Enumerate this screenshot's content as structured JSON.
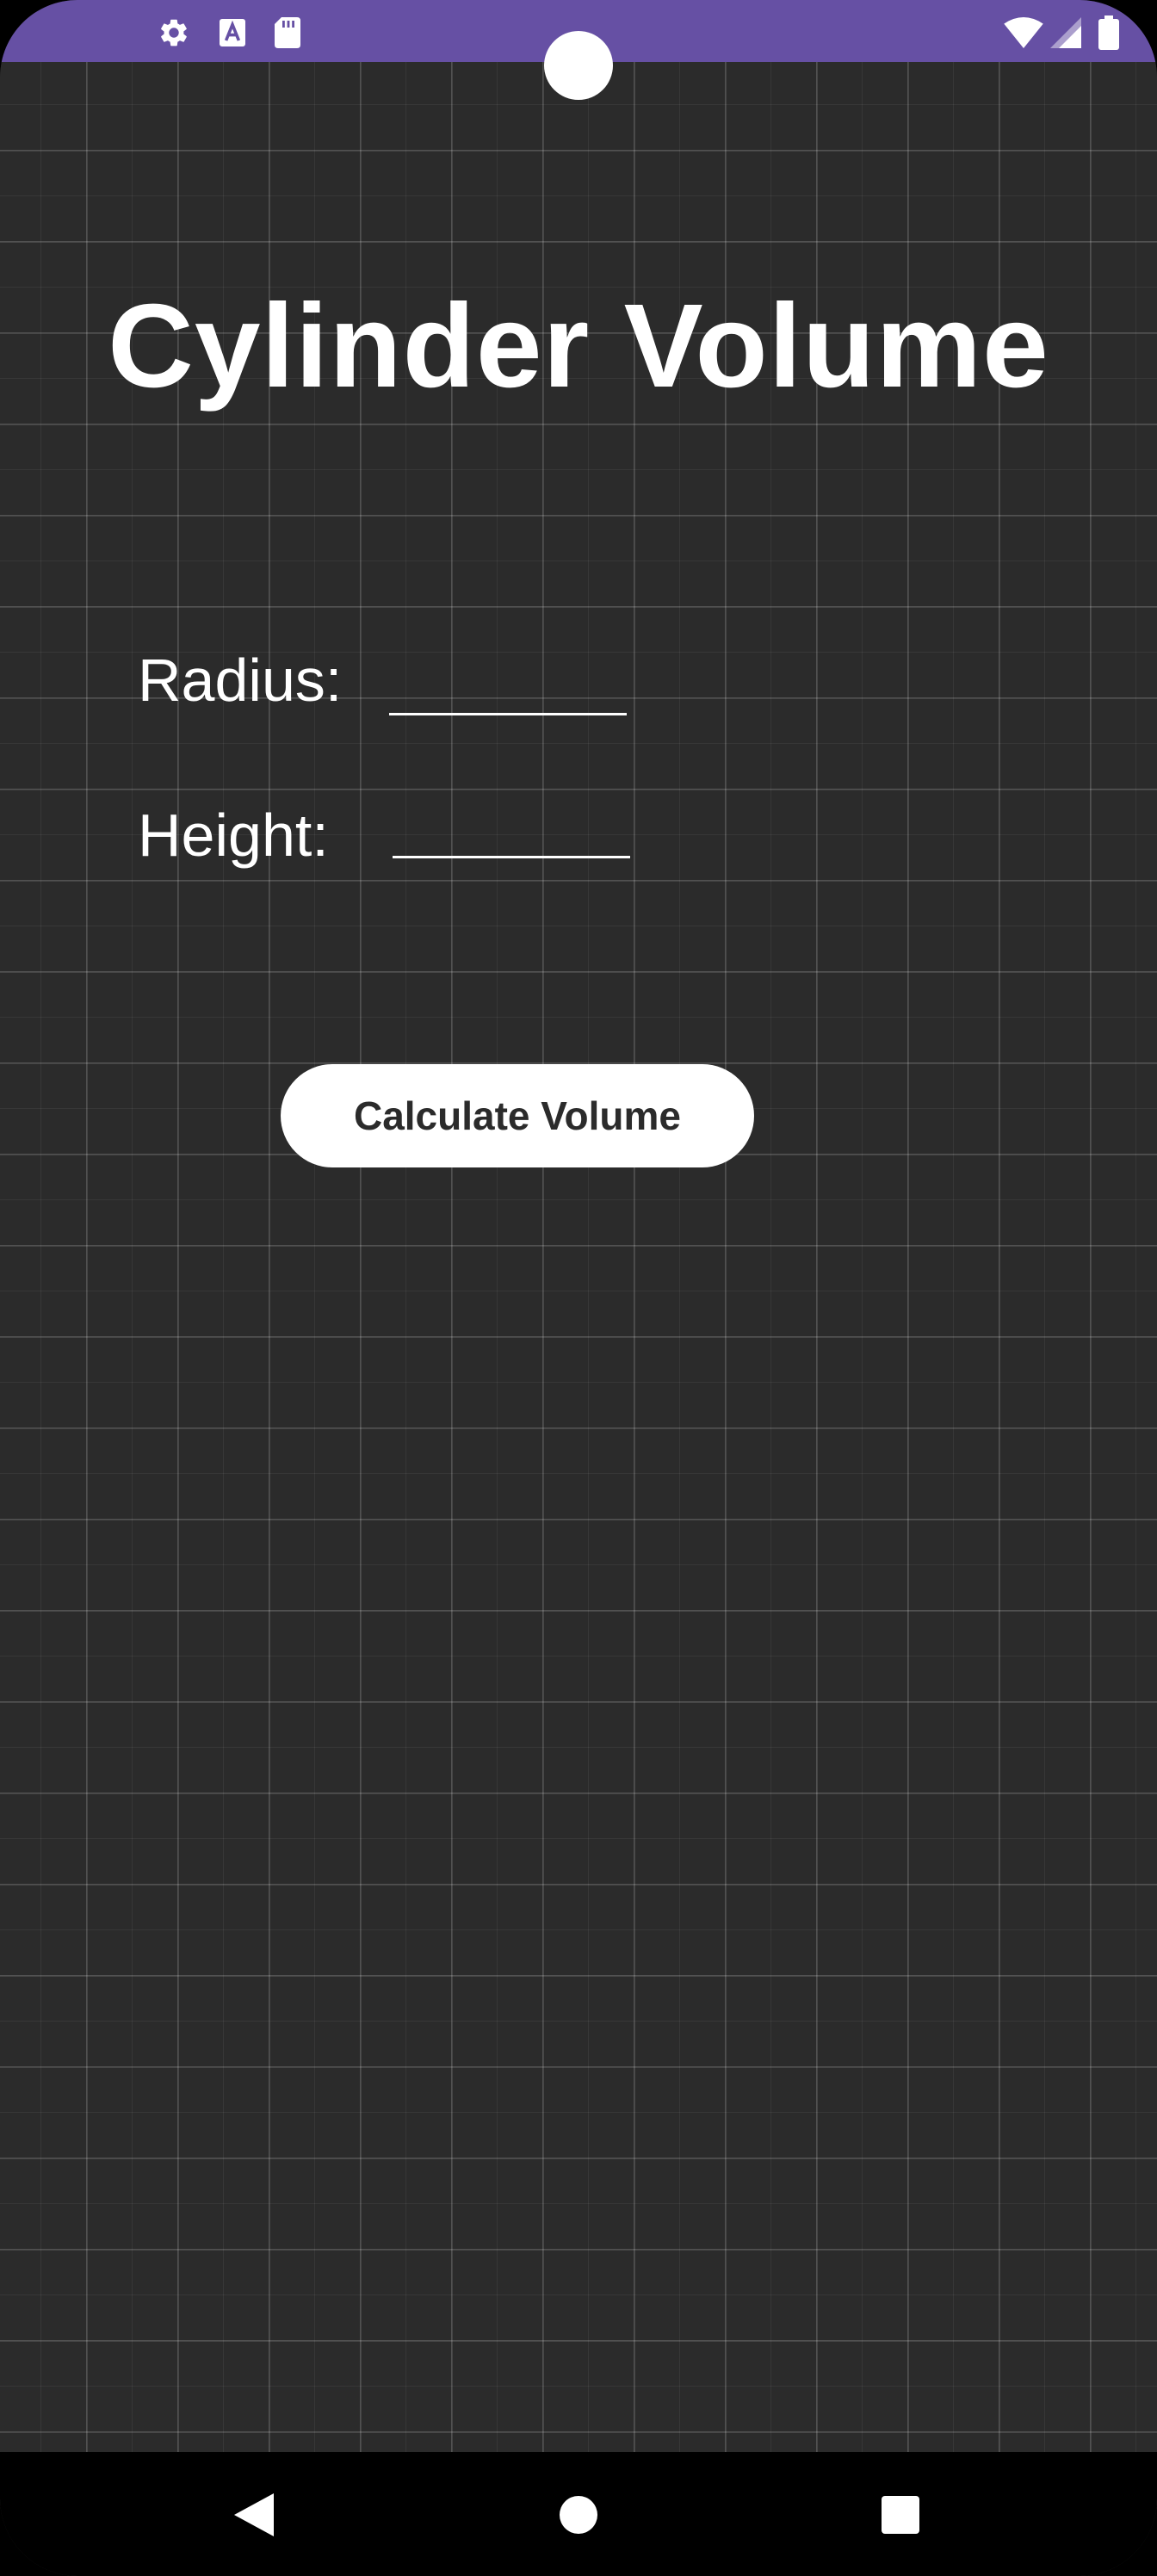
{
  "app": {
    "title": "Cylinder Volume"
  },
  "form": {
    "radius_label": "Radius:",
    "radius_value": "",
    "height_label": "Height:",
    "height_value": ""
  },
  "actions": {
    "calculate_label": "Calculate Volume"
  },
  "status_bar": {
    "left_icons": [
      "gear-icon",
      "text-a-icon",
      "sd-card-icon"
    ],
    "right_icons": [
      "wifi-icon",
      "signal-icon",
      "battery-icon"
    ]
  },
  "nav_bar": {
    "buttons": [
      "back-icon",
      "home-icon",
      "recents-icon"
    ]
  },
  "colors": {
    "status_bar": "#6650a4",
    "background": "#2b2b2b",
    "button_bg": "#ffffff",
    "button_text": "#2b2b2b",
    "text": "#ffffff"
  }
}
